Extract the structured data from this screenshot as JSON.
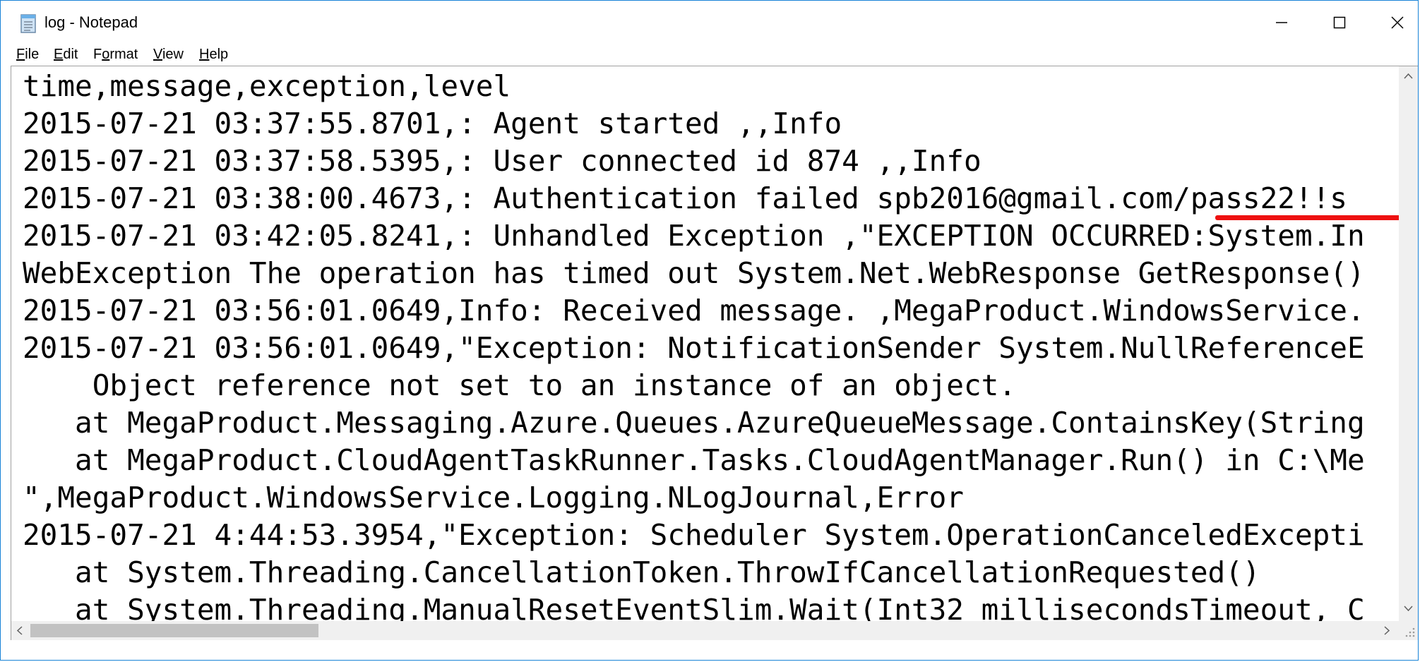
{
  "window": {
    "title": "log - Notepad",
    "icon": "notepad-icon",
    "controls": {
      "minimize": "minimize-icon",
      "maximize": "maximize-icon",
      "close": "close-icon"
    }
  },
  "menu": {
    "items": [
      {
        "label_u": "F",
        "label_rest": "ile"
      },
      {
        "label_u": "E",
        "label_rest": "dit"
      },
      {
        "label_pre": "F",
        "label_u": "o",
        "label_rest": "rmat"
      },
      {
        "label_u": "V",
        "label_rest": "iew"
      },
      {
        "label_u": "H",
        "label_rest": "elp"
      }
    ]
  },
  "editor": {
    "lines": [
      "time,message,exception,level",
      "2015-07-21 03:37:55.8701,: Agent started ,,Info",
      "2015-07-21 03:37:58.5395,: User connected id 874 ,,Info",
      "2015-07-21 03:38:00.4673,: Authentication failed spb2016@gmail.com/pass22!!s",
      "2015-07-21 03:42:05.8241,: Unhandled Exception ,\"EXCEPTION OCCURRED:System.In",
      "WebException The operation has timed out System.Net.WebResponse GetResponse()",
      "2015-07-21 03:56:01.0649,Info: Received message. ,MegaProduct.WindowsService.",
      "2015-07-21 03:56:01.0649,\"Exception: NotificationSender System.NullReferenceE",
      "    Object reference not set to an instance of an object.",
      "   at MegaProduct.Messaging.Azure.Queues.AzureQueueMessage.ContainsKey(String",
      "   at MegaProduct.CloudAgentTaskRunner.Tasks.CloudAgentManager.Run() in C:\\Me",
      "\",MegaProduct.WindowsService.Logging.NLogJournal,Error",
      "2015-07-21 4:44:53.3954,\"Exception: Scheduler System.OperationCanceledExcepti",
      "   at System.Threading.CancellationToken.ThrowIfCancellationRequested()",
      "   at System.Threading.ManualResetEventSlim.Wait(Int32 millisecondsTimeout, C"
    ],
    "annotation_color": "#ee1111"
  }
}
